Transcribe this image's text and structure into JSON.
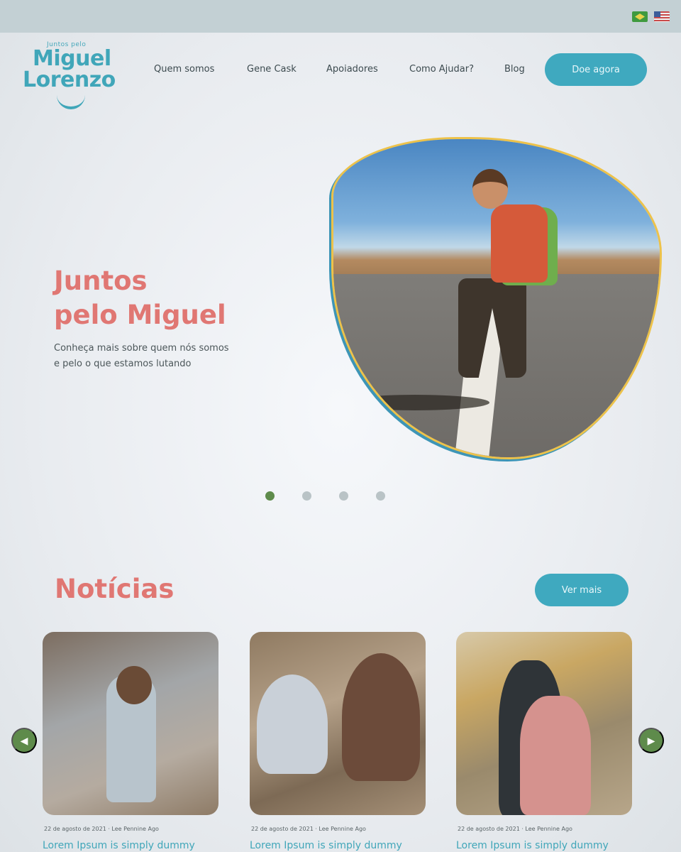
{
  "header": {
    "languages": [
      {
        "name": "brazil-flag-icon"
      },
      {
        "name": "usa-flag-icon"
      }
    ],
    "logo": {
      "small": "Juntos pelo",
      "line1": "Miguel",
      "line2": "Lorenzo"
    },
    "nav": [
      {
        "label": "Quem somos"
      },
      {
        "label": "Gene Cask"
      },
      {
        "label": "Apoiadores"
      },
      {
        "label": "Como Ajudar?"
      },
      {
        "label": "Blog"
      }
    ],
    "cta_label": "Doe agora"
  },
  "hero": {
    "title_line1": "Juntos",
    "title_line2": "pelo Miguel",
    "subtitle_line1": "Conheça mais sobre quem nós somos",
    "subtitle_line2": "e pelo o que estamos lutando",
    "slides_total": 4,
    "slide_active": 1
  },
  "news": {
    "title": "Notícias",
    "more_label": "Ver mais",
    "cards": [
      {
        "meta": "22 de agosto de 2021 · Lee Pennine Ago",
        "headline": "Lorem Ipsum is simply dummy"
      },
      {
        "meta": "22 de agosto de 2021 · Lee Pennine Ago",
        "headline": "Lorem Ipsum is simply dummy"
      },
      {
        "meta": "22 de agosto de 2021 · Lee Pennine Ago",
        "headline": "Lorem Ipsum is simply dummy"
      }
    ],
    "prev_icon": "arrow-left-icon",
    "next_icon": "arrow-right-icon"
  },
  "colors": {
    "accent": "#3fa9bf",
    "title": "#e07773",
    "pager_active": "#5e8b4b"
  }
}
